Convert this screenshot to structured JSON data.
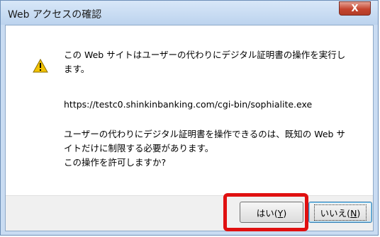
{
  "dialog": {
    "title": "Web アクセスの確認",
    "close_label": "X",
    "message_line1": "この Web サイトはユーザーの代わりにデジタル証明書の操作を実行し",
    "message_line2": "ます。",
    "url": "https://testc0.shinkinbanking.com/cgi-bin/sophialite.exe",
    "note_line1": "ユーザーの代わりにデジタル証明書を操作できるのは、既知の Web サ",
    "note_line2": "イトだけに制限する必要があります。",
    "question": "この操作を許可しますか?",
    "yes_prefix": "はい(",
    "yes_key": "Y",
    "yes_suffix": ")",
    "no_prefix": "いいえ(",
    "no_key": "N",
    "no_suffix": ")"
  },
  "colors": {
    "title_bar": "#bcd3ee",
    "close_button": "#c5452f",
    "highlight_box": "#e01010",
    "warning_icon": "#f2c200"
  },
  "icons": {
    "warning": "warning-icon"
  }
}
